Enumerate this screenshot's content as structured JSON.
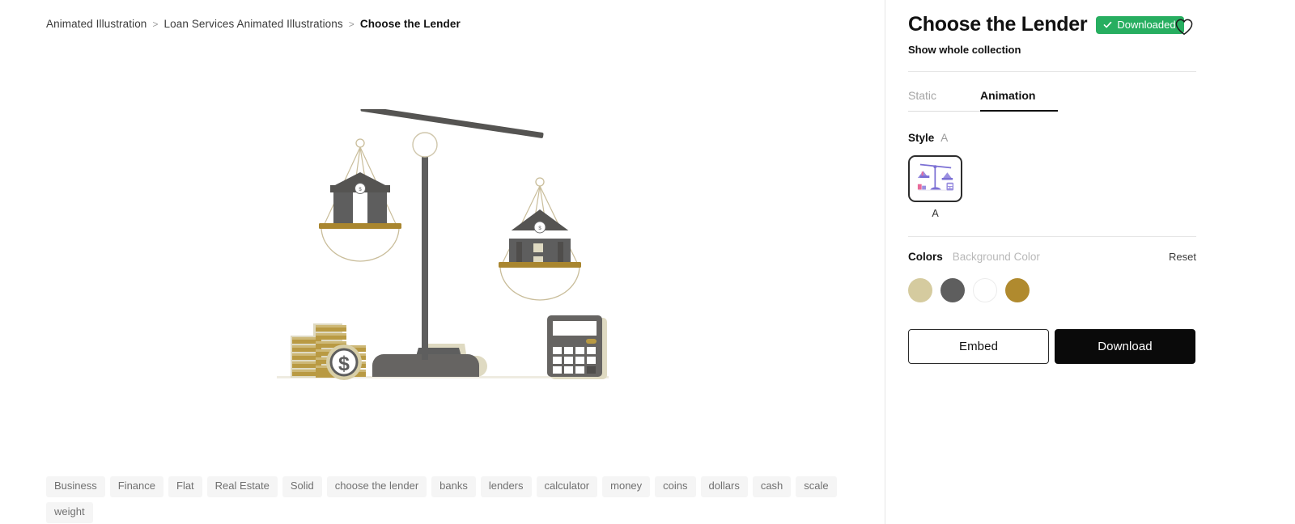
{
  "breadcrumb": {
    "items": [
      {
        "label": "Animated Illustration",
        "current": false
      },
      {
        "label": "Loan Services Animated Illustrations",
        "current": false
      },
      {
        "label": "Choose the Lender",
        "current": true
      }
    ],
    "separator": ">"
  },
  "illustration": {
    "name": "choose-the-lender-scale-illustration",
    "alt": "Balance scale weighing two bank buildings with coin stacks and a calculator",
    "colors": {
      "dark_gray": "#5e5e5e",
      "darker_gray": "#565656",
      "beige_shadow": "#ded9c0",
      "gold": "#a9862f",
      "coin_gold": "#b99a43",
      "coin_light": "#d8cfa8",
      "white": "#ffffff",
      "string": "#c9bd9a"
    }
  },
  "tags": [
    "Business",
    "Finance",
    "Flat",
    "Real Estate",
    "Solid",
    "choose the lender",
    "banks",
    "lenders",
    "calculator",
    "money",
    "coins",
    "dollars",
    "cash",
    "scale",
    "weight"
  ],
  "panel": {
    "title": "Choose the Lender",
    "badge": {
      "label": "Downloaded",
      "icon": "check-icon",
      "color": "#27ae60"
    },
    "favorite_icon": "heart-icon",
    "subtitle": "Show whole collection",
    "tabs": [
      {
        "label": "Static",
        "active": false
      },
      {
        "label": "Animation",
        "active": true
      }
    ],
    "style": {
      "label": "Style",
      "value": "A"
    },
    "style_cards": [
      {
        "caption": "A",
        "selected": true
      }
    ],
    "colors_section": {
      "label": "Colors",
      "background_color_label": "Background Color",
      "reset_label": "Reset",
      "swatches": [
        {
          "name": "khaki",
          "hex": "#d5cb9f"
        },
        {
          "name": "dark-gray",
          "hex": "#5e5e5e"
        },
        {
          "name": "white",
          "hex": "#ffffff"
        },
        {
          "name": "gold",
          "hex": "#b08a2e"
        }
      ]
    },
    "actions": {
      "embed_label": "Embed",
      "download_label": "Download"
    }
  }
}
